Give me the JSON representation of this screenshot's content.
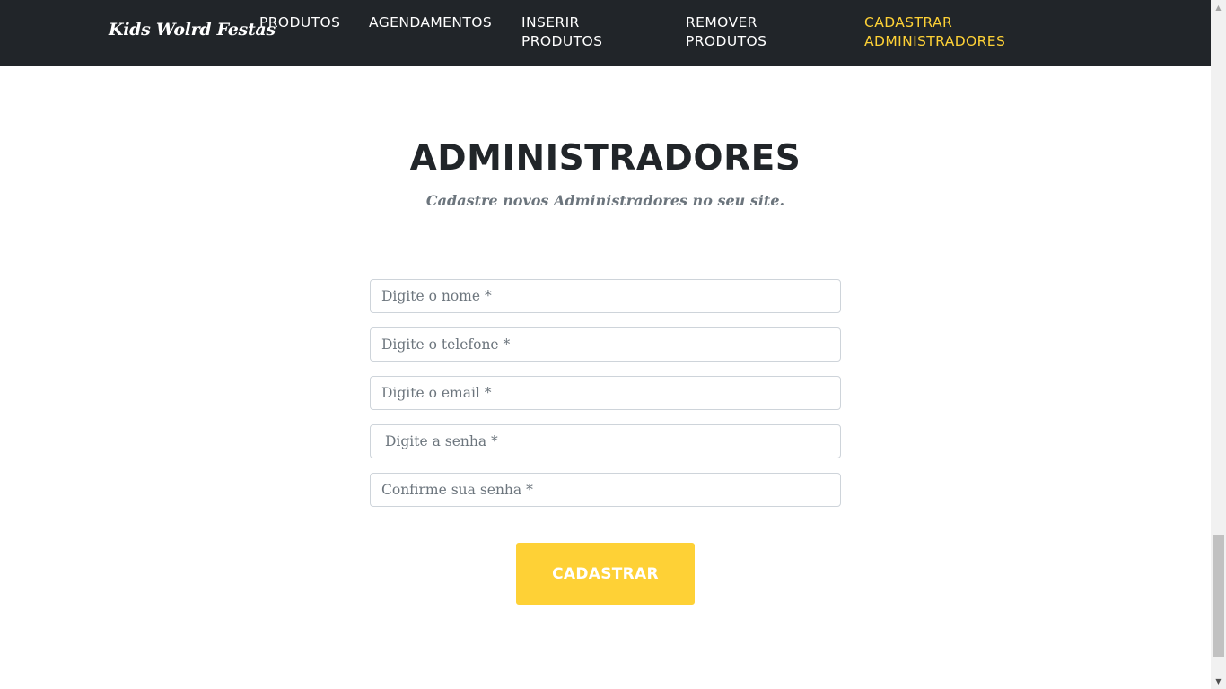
{
  "navbar": {
    "brand": "Kids Wolrd Festas",
    "items": [
      {
        "label": "PRODUTOS",
        "active": false
      },
      {
        "label": "AGENDAMENTOS",
        "active": false
      },
      {
        "label": "INSERIR PRODUTOS",
        "active": false
      },
      {
        "label": "REMOVER PRODUTOS",
        "active": false
      },
      {
        "label": "CADASTRAR ADMINISTRADORES",
        "active": true
      }
    ]
  },
  "section": {
    "heading": "ADMINISTRADORES",
    "subheading": "Cadastre novos Administradores no seu site."
  },
  "form": {
    "fields": [
      {
        "placeholder": "Digite o nome *",
        "value": ""
      },
      {
        "placeholder": "Digite o telefone *",
        "value": ""
      },
      {
        "placeholder": "Digite o email *",
        "value": ""
      },
      {
        "placeholder": "Digite a senha *",
        "value": ""
      },
      {
        "placeholder": "Confirme sua senha *",
        "value": ""
      }
    ],
    "submit_label": "CADASTRAR"
  },
  "colors": {
    "navbar_bg": "#212529",
    "accent": "#fed136",
    "heading": "#212529",
    "muted": "#6c757d"
  },
  "icons": {
    "scroll_up": "triangle-up-icon",
    "scroll_down": "triangle-down-icon"
  }
}
